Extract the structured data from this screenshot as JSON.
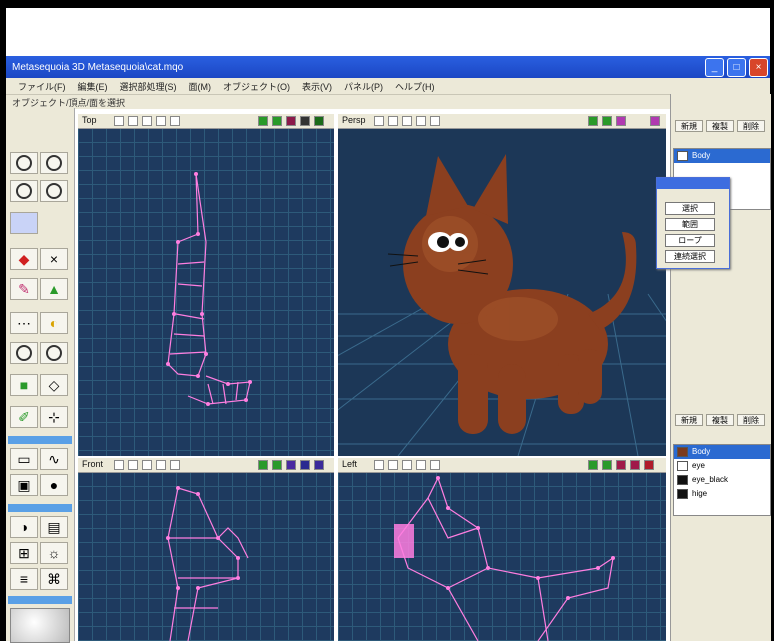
{
  "window": {
    "title": "Metasequoia 3D  Metasequoia\\cat.mqo",
    "controls": [
      "_",
      "□",
      "×"
    ]
  },
  "menubar": {
    "items": [
      "ファイル(F)",
      "編集(E)",
      "選択部処理(S)",
      "面(M)",
      "オブジェクト(O)",
      "表示(V)",
      "パネル(P)",
      "ヘルプ(H)"
    ]
  },
  "statusline": {
    "text": "オブジェクト/頂点/面を選択"
  },
  "viewports": {
    "top": {
      "label": "Top"
    },
    "persp": {
      "label": "Persp"
    },
    "front": {
      "label": "Front"
    },
    "left": {
      "label": "Left"
    }
  },
  "right_panel": {
    "top_buttons": [
      "新規",
      "複製",
      "削除"
    ],
    "objects": [
      {
        "name": "Body",
        "selected": true,
        "color": "#2b6ad1"
      }
    ],
    "mid_buttons": [
      "新規",
      "複製",
      "削除"
    ],
    "materials": [
      {
        "name": "Body",
        "selected": true,
        "color": "#7b3a1e"
      },
      {
        "name": "eye",
        "selected": false,
        "color": "#ffffff"
      },
      {
        "name": "eye_black",
        "selected": false,
        "color": "#111111"
      },
      {
        "name": "hige",
        "selected": false,
        "color": "#111111"
      }
    ]
  },
  "popup": {
    "buttons": [
      "選択",
      "範囲",
      "ロープ",
      "連続選択"
    ]
  },
  "colors": {
    "viewport_bg": "#1e3a5f",
    "wireframe": "#ff7ee0",
    "cat_body": "#8b3f1f",
    "titlebar": "#1b47c4"
  }
}
